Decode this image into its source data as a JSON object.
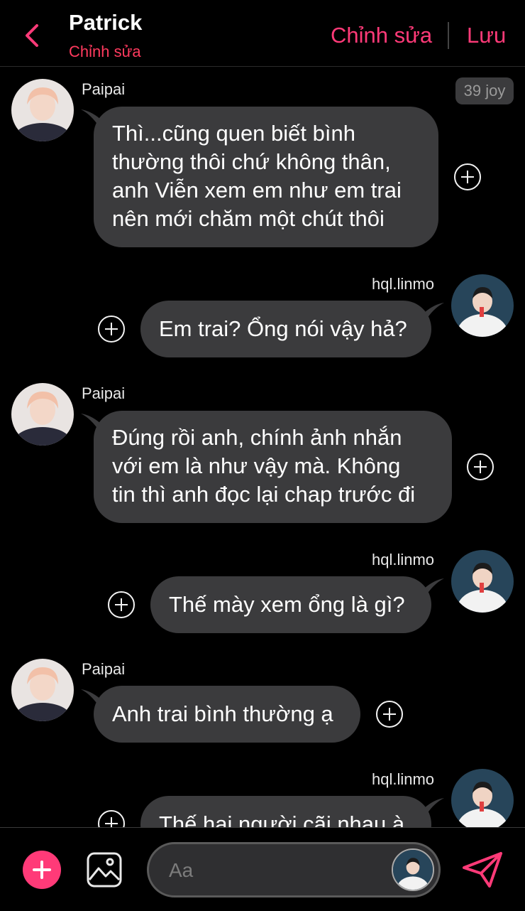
{
  "header": {
    "title": "Patrick",
    "subtitle": "Chỉnh sửa",
    "edit_label": "Chỉnh sửa",
    "save_label": "Lưu"
  },
  "badge": "39 joy",
  "messages": [
    {
      "sender": "Paipai",
      "side": "left",
      "lines": [
        "Thì...cũng quen biết bình",
        "thường thôi chứ không thân,",
        "anh Viễn xem em như em trai",
        "nên mới chăm một chút thôi"
      ]
    },
    {
      "sender": "hql.linmo",
      "side": "right",
      "lines": [
        "Em trai? Ổng nói vậy hả?"
      ]
    },
    {
      "sender": "Paipai",
      "side": "left",
      "lines": [
        "Đúng rồi anh, chính ảnh nhắn",
        "với em là như vậy mà. Không",
        "tin thì anh đọc lại chap trước đi"
      ]
    },
    {
      "sender": "hql.linmo",
      "side": "right",
      "lines": [
        "Thế mày xem ổng là gì?"
      ]
    },
    {
      "sender": "Paipai",
      "side": "left",
      "lines": [
        "Anh trai bình thường ạ"
      ]
    },
    {
      "sender": "hql.linmo",
      "side": "right",
      "lines": [
        "Thế hai người cãi nhau à"
      ]
    }
  ],
  "composer": {
    "placeholder": "Aa"
  },
  "colors": {
    "accent": "#ff3a78",
    "bubble": "#3b3b3d",
    "background": "#000000"
  },
  "icons": {
    "back": "chevron-left-icon",
    "add": "plus-icon",
    "image": "image-icon",
    "send": "send-icon",
    "react": "plus-circle-icon"
  }
}
